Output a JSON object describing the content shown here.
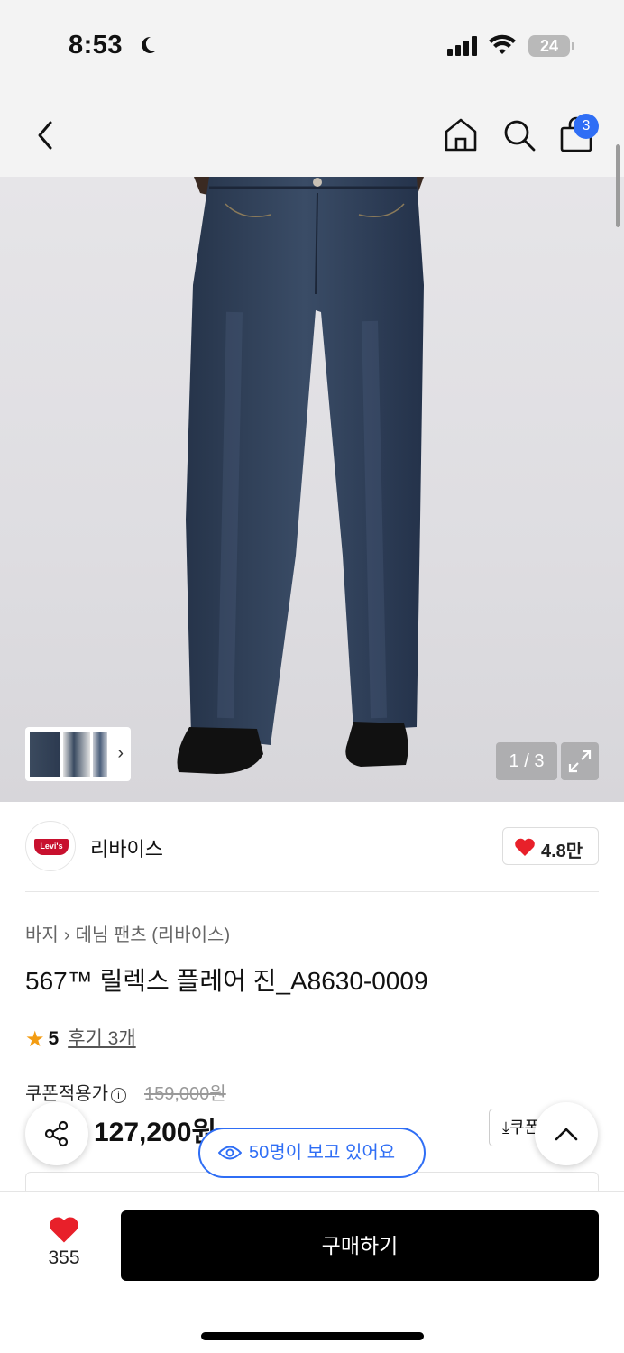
{
  "status_bar": {
    "time": "8:53",
    "battery": "24"
  },
  "header": {
    "cart_count": "3"
  },
  "gallery": {
    "counter": "1 / 3"
  },
  "brand": {
    "logo_text": "Levi's",
    "name": "리바이스",
    "likes": "4.8만"
  },
  "breadcrumb": {
    "level1": "바지",
    "level2": "데님 팬츠 (리바이스)"
  },
  "product": {
    "title": "567™ 릴렉스 플레어 진_A8630-0009",
    "rating": "5",
    "reviews": "후기 3개",
    "price_label": "쿠폰적용가",
    "original_price": "159,000원",
    "sale_price": "127,200원",
    "coupon_button": "쿠폰"
  },
  "viewers": {
    "text": "50명이 보고 있어요"
  },
  "bottom": {
    "wish_count": "355",
    "buy_label": "구매하기"
  },
  "colors": {
    "accent": "#2f6ef5",
    "heart": "#e8202a",
    "buy": "#000000",
    "star": "#f39c12"
  }
}
